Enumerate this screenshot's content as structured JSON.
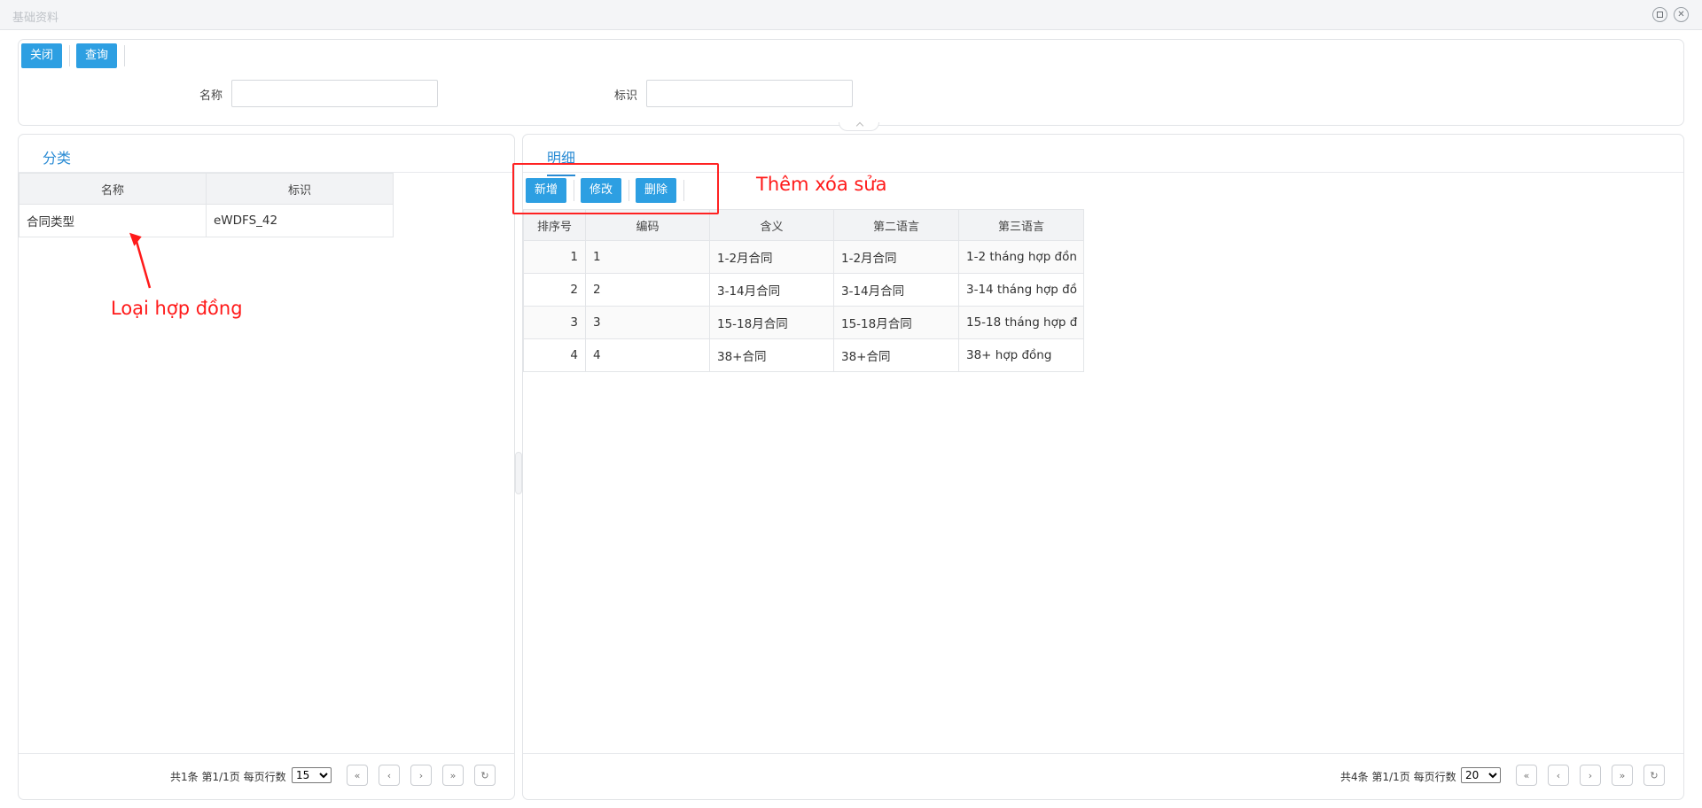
{
  "window": {
    "title": "基础资料"
  },
  "toolbar": {
    "close_label": "关闭",
    "query_label": "查询"
  },
  "query": {
    "name_label": "名称",
    "name_value": "",
    "id_label": "标识",
    "id_value": ""
  },
  "category": {
    "tab_label": "分类",
    "columns": [
      "名称",
      "标识"
    ],
    "rows": [
      {
        "name": "合同类型",
        "id": "eWDFS_42"
      }
    ],
    "pager": {
      "info": "共1条 第1/1页 每页行数",
      "page_size": "15"
    }
  },
  "detail": {
    "tab_label": "明细",
    "add_label": "新增",
    "edit_label": "修改",
    "delete_label": "删除",
    "columns": [
      "排序号",
      "编码",
      "含义",
      "第二语言",
      "第三语言"
    ],
    "rows": [
      {
        "seq": "1",
        "code": "1",
        "meaning": "1-2月合同",
        "lang2": "1-2月合同",
        "lang3": "1-2 tháng hợp đồn"
      },
      {
        "seq": "2",
        "code": "2",
        "meaning": "3-14月合同",
        "lang2": "3-14月合同",
        "lang3": "3-14 tháng hợp đồ"
      },
      {
        "seq": "3",
        "code": "3",
        "meaning": "15-18月合同",
        "lang2": "15-18月合同",
        "lang3": "15-18 tháng hợp đ"
      },
      {
        "seq": "4",
        "code": "4",
        "meaning": "38+合同",
        "lang2": "38+合同",
        "lang3": "38+ hợp đồng"
      }
    ],
    "pager": {
      "info": "共4条 第1/1页 每页行数",
      "page_size": "20"
    }
  },
  "annotations": {
    "crud_note": "Thêm xóa sửa",
    "contract_type_note": "Loại hợp đồng"
  },
  "colors": {
    "accent": "#2d9fe2",
    "tab_active": "#2a8bd4",
    "annotation": "#ff1a1a"
  }
}
